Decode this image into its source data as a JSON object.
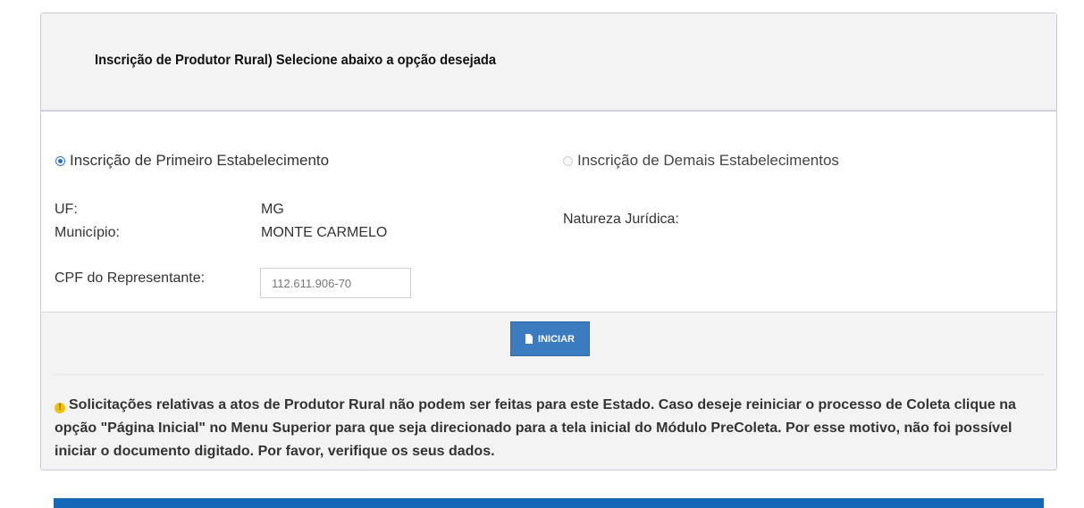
{
  "header": {
    "title": "Inscrição de Produtor Rural) Selecione abaixo a opção desejada"
  },
  "options": {
    "first": {
      "label": "Inscrição de Primeiro Estabelecimento",
      "selected": true
    },
    "others": {
      "label": "Inscrição de Demais Estabelecimentos",
      "selected": false
    }
  },
  "fields": {
    "uf_label": "UF:",
    "uf_value": "MG",
    "municipio_label": "Município:",
    "municipio_value": "MONTE CARMELO",
    "natureza_label": "Natureza Jurídica:",
    "cpf_label": "CPF do Representante:",
    "cpf_value": "112.611.906-70"
  },
  "actions": {
    "iniciar_label": "INICIAR",
    "iniciar_icon": "file-icon"
  },
  "notice": {
    "icon": "warning-icon",
    "text": "Solicitações relativas a atos de Produtor Rural não podem ser feitas para este Estado. Caso deseje reiniciar o processo de Coleta clique na opção \"Página Inicial\" no Menu Superior para que seja direcionado para a tela inicial do Módulo PreColeta. Por esse motivo, não foi possível iniciar o documento digitado. Por favor, verifique os seus dados."
  },
  "colors": {
    "primary": "#3b7bbf",
    "bottom_bar": "#1568b6",
    "warning": "#f2c100"
  }
}
